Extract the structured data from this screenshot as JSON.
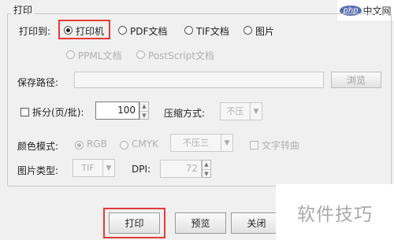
{
  "group_title": "打印",
  "print_to": {
    "label": "打印到:",
    "options": [
      {
        "label": "打印机"
      },
      {
        "label": "PDF文档"
      },
      {
        "label": "TIF文档"
      },
      {
        "label": "图片"
      }
    ],
    "sub_options": [
      {
        "label": "PPML文档"
      },
      {
        "label": "PostScript文档"
      }
    ]
  },
  "save_path": {
    "label": "保存路径:",
    "value": "",
    "browse_label": "浏览"
  },
  "split": {
    "label": "拆分(页/批):",
    "value": "100"
  },
  "compression": {
    "label": "压缩方式:",
    "value": "不压"
  },
  "color_mode": {
    "label": "颜色模式:",
    "options": [
      {
        "label": "RGB"
      },
      {
        "label": "CMYK"
      }
    ],
    "dropdown_value": "不压三",
    "text_to_curve_label": "文字转曲"
  },
  "image_type": {
    "label": "图片类型:",
    "value": "TIF"
  },
  "dpi": {
    "label": "DPI:",
    "value": "72"
  },
  "buttons": {
    "print": "打印",
    "preview": "预览",
    "close": "关闭"
  },
  "watermarks": {
    "php_logo": "php",
    "php_site": "中文网",
    "tips": "软件技巧"
  },
  "colors": {
    "highlight": "#e23b3b"
  }
}
